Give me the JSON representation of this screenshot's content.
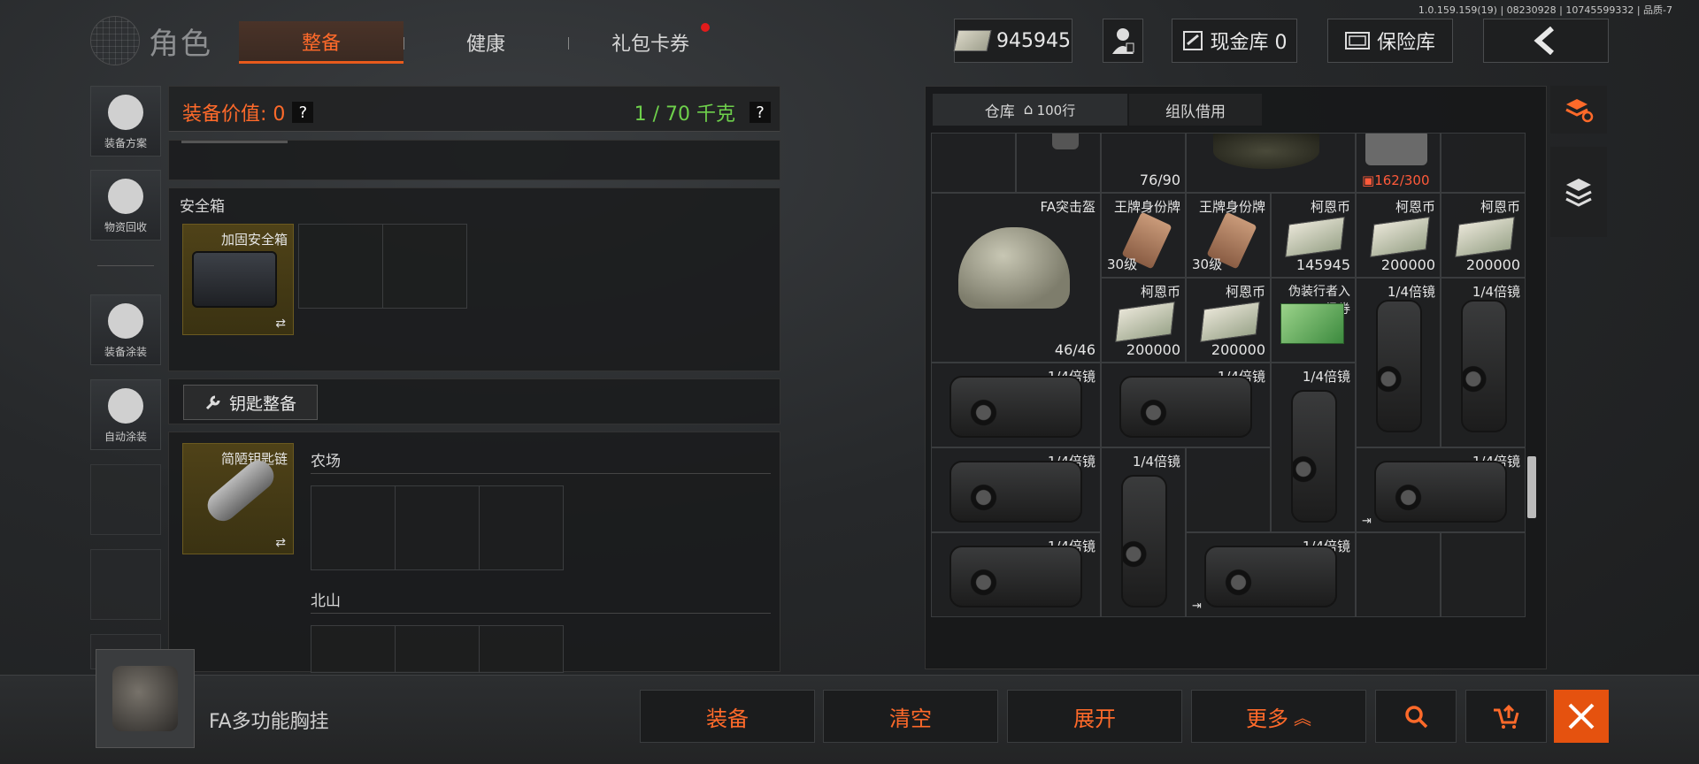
{
  "version": "1.0.159.159(19) | 08230928 | 10745599332 | 品质-7",
  "title": "角色",
  "tabs": [
    {
      "label": "整备",
      "active": true
    },
    {
      "label": "健康",
      "active": false
    },
    {
      "label": "礼包卡券",
      "active": false,
      "notification": true
    }
  ],
  "currency": {
    "amount": "945945"
  },
  "cash_vault": {
    "label": "现金库 0"
  },
  "insurance": {
    "label": "保险库"
  },
  "sidebar": [
    {
      "label": "装备方案",
      "icon": "equipment-plan-icon"
    },
    {
      "label": "物资回收",
      "icon": "recycle-icon"
    },
    {
      "label": "装备涂装",
      "icon": "paint-icon"
    },
    {
      "label": "自动涂装",
      "icon": "auto-paint-icon"
    }
  ],
  "equipment": {
    "value_label": "装备价值: 0",
    "weight_label": "1 / 70 千克",
    "help": "?"
  },
  "safe_box": {
    "section_label": "安全箱",
    "item_name": "加固安全箱"
  },
  "keys": {
    "button_label": "钥匙整备",
    "item_name": "简陋钥匙链",
    "areas": [
      "农场",
      "北山"
    ]
  },
  "warehouse": {
    "tab_label": "仓库",
    "capacity": "100行",
    "team_tab": "组队借用",
    "items": {
      "top_count": "76/90",
      "top_durability": "162/300",
      "helmet": {
        "name": "FA突击盔",
        "durability": "46/46"
      },
      "tags": [
        {
          "name": "王牌身份牌",
          "level": "30级"
        },
        {
          "name": "王牌身份牌",
          "level": "30级"
        }
      ],
      "coins_row1": [
        {
          "name": "柯恩币",
          "amount": "145945"
        },
        {
          "name": "柯恩币",
          "amount": "200000"
        },
        {
          "name": "柯恩币",
          "amount": "200000"
        }
      ],
      "coins_row2": [
        {
          "name": "柯恩币",
          "amount": "200000"
        },
        {
          "name": "柯恩币",
          "amount": "200000"
        }
      ],
      "ticket": {
        "name": "伪装行者入场券"
      },
      "scope_label": "1/4倍镜"
    }
  },
  "selected_item": {
    "name": "FA多功能胸挂"
  },
  "actions": [
    "装备",
    "清空",
    "展开",
    "更多"
  ],
  "colors": {
    "accent": "#ff6a2a",
    "weight_green": "#6ed04b",
    "notify": "#e21b1b"
  }
}
